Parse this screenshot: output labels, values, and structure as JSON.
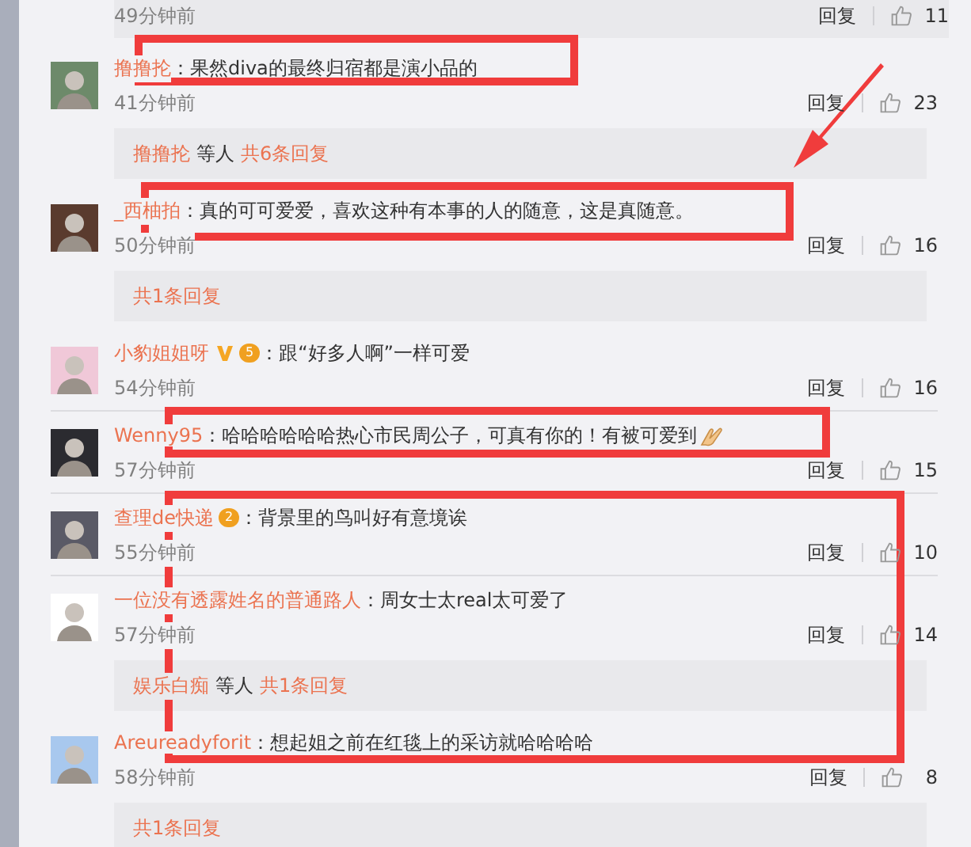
{
  "comments": [
    {
      "kind": "nested",
      "time": "49分钟前",
      "reply_label": "回复",
      "likes": "11"
    },
    {
      "kind": "comment",
      "user": "撸撸抡",
      "text": "：果然diva的最终归宿都是演小品的",
      "time": "41分钟前",
      "reply_label": "回复",
      "likes": "23"
    },
    {
      "kind": "replies",
      "names": "撸撸抡",
      "middle": "等人",
      "count": "共6条回复"
    },
    {
      "kind": "comment",
      "user": "_西柚拍",
      "text": "：真的可可爱爱，喜欢这种有本事的人的随意，这是真随意。",
      "time": "50分钟前",
      "reply_label": "回复",
      "likes": "16"
    },
    {
      "kind": "replies",
      "count": "共1条回复"
    },
    {
      "kind": "comment",
      "user": "小豹姐姐呀",
      "verified": true,
      "crown_level": "5",
      "text": "：跟“好多人啊”一样可爱",
      "time": "54分钟前",
      "reply_label": "回复",
      "likes": "16"
    },
    {
      "kind": "comment",
      "user": "Wenny95",
      "text": "：哈哈哈哈哈哈热心市民周公子，可真有你的！有被可爱到",
      "emoji": true,
      "time": "57分钟前",
      "reply_label": "回复",
      "likes": "15"
    },
    {
      "kind": "comment",
      "user": "查理de快递",
      "crown_level": "2",
      "text": "：背景里的鸟叫好有意境诶",
      "time": "55分钟前",
      "reply_label": "回复",
      "likes": "10"
    },
    {
      "kind": "comment",
      "user": "一位没有透露姓名的普通路人",
      "text": "：周女士太real太可爱了",
      "time": "57分钟前",
      "reply_label": "回复",
      "likes": "14"
    },
    {
      "kind": "replies",
      "names": "娱乐白痴",
      "middle": "等人",
      "count": "共1条回复"
    },
    {
      "kind": "comment",
      "user": "Areureadyforit",
      "text": "：想起姐之前在红毯上的采访就哈哈哈哈",
      "time": "58分钟前",
      "reply_label": "回复",
      "likes": "8"
    },
    {
      "kind": "replies",
      "count": "共1条回复"
    }
  ],
  "annotations": [
    {
      "kind": "box"
    },
    {
      "kind": "arrow"
    },
    {
      "kind": "box"
    },
    {
      "kind": "box"
    },
    {
      "kind": "box"
    }
  ]
}
